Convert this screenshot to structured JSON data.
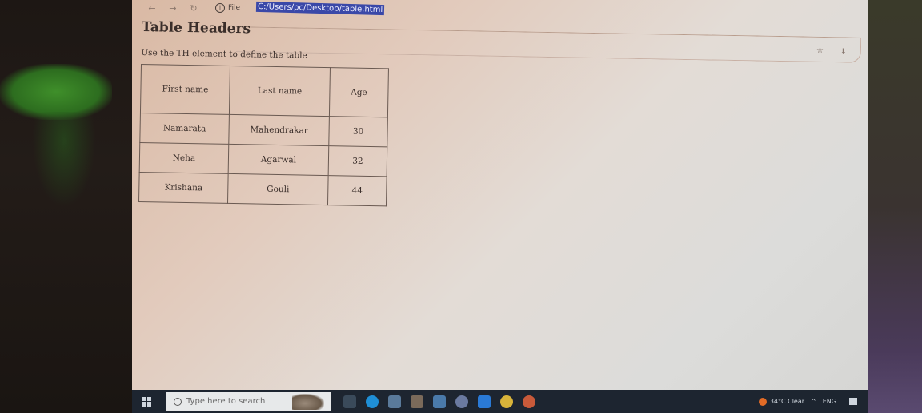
{
  "browser": {
    "addr_label": "File",
    "url": "C:/Users/pc/Desktop/table.html"
  },
  "page": {
    "title": "Table Headers",
    "description": "Use the TH element to define the table",
    "table": {
      "headers": [
        "First name",
        "Last name",
        "Age"
      ],
      "rows": [
        [
          "Namarata",
          "Mahendrakar",
          "30"
        ],
        [
          "Neha",
          "Agarwal",
          "32"
        ],
        [
          "Krishana",
          "Gouli",
          "44"
        ]
      ]
    }
  },
  "taskbar": {
    "search_placeholder": "Type here to search",
    "weather": "34°C Clear",
    "lang": "ENG"
  },
  "colors": {
    "url_highlight": "#3a48a8",
    "taskbar": "#1d2530"
  }
}
